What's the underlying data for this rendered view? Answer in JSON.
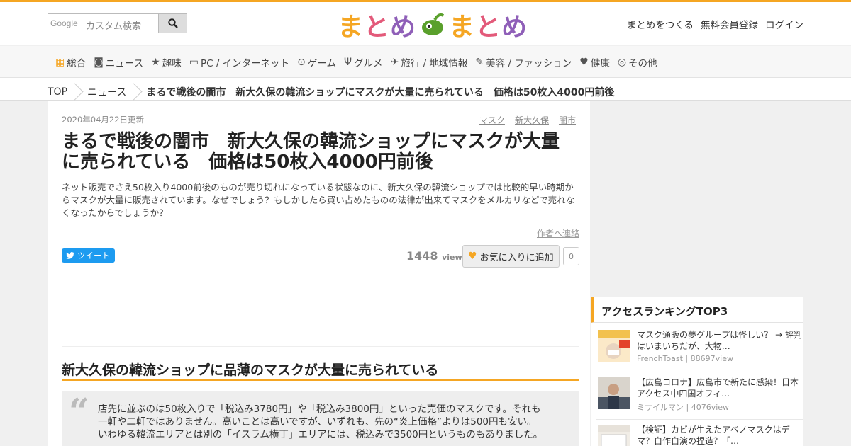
{
  "header": {
    "search_brand": "Google",
    "search_placeholder": "カスタム検索",
    "logo_chars": [
      "ま",
      "と",
      "め",
      "ま",
      "と",
      "め"
    ],
    "logo_colors": [
      "#f5a623",
      "#e35a7a",
      "#8f5fb8",
      "#f5a623",
      "#e35a7a",
      "#8f5fb8"
    ],
    "links": [
      "まとめをつくる",
      "無料会員登録",
      "ログイン"
    ]
  },
  "nav": {
    "items": [
      {
        "label": "総合",
        "icon": "grid-icon"
      },
      {
        "label": "ニュース",
        "icon": "camera-icon"
      },
      {
        "label": "趣味",
        "icon": "star-icon"
      },
      {
        "label": "PC / インターネット",
        "icon": "monitor-icon"
      },
      {
        "label": "ゲーム",
        "icon": "gamepad-icon"
      },
      {
        "label": "グルメ",
        "icon": "cutlery-icon"
      },
      {
        "label": "旅行 / 地域情報",
        "icon": "plane-icon"
      },
      {
        "label": "美容 / ファッション",
        "icon": "brush-icon"
      },
      {
        "label": "健康",
        "icon": "heartbeat-icon"
      },
      {
        "label": "その他",
        "icon": "dots-icon"
      }
    ]
  },
  "breadcrumb": {
    "top": "TOP",
    "category": "ニュース",
    "current": "まるで戦後の闇市　新大久保の韓流ショップにマスクが大量に売られている　価格は50枚入4000円前後"
  },
  "article": {
    "updated": "2020年04月22日更新",
    "tags": [
      "マスク",
      "新大久保",
      "闇市"
    ],
    "title": "まるで戦後の闇市　新大久保の韓流ショップにマスクが大量に売られている　価格は50枚入4000円前後",
    "description": "ネット販売でさえ50枚入り4000前後のものが売り切れになっている状態なのに、新大久保の韓流ショップでは比較的早い時期からマスクが大量に販売されています。なぜでしょう？もしかしたら買い占めたものの法律が出来てマスクをメルカリなどで売れなくなったからでしょうか？",
    "contact_author": "作者へ連絡",
    "tweet_label": "ツイート",
    "view_count": "1448",
    "view_unit": "view",
    "favorite_label": "お気に入りに追加",
    "favorite_count": "0",
    "section_heading": "新大久保の韓流ショップに品薄のマスクが大量に売られている",
    "quote_text": "店先に並ぶのは50枚入りで「税込み3780円」や「税込み3800円」といった売価のマスクです。それも一軒や二軒ではありません。高いことは高いですが、いずれも、先の“炎上価格”よりは500円も安い。いわゆる韓流エリアとは別の「イスラム横丁」エリアには、税込みで3500円というものもありました。"
  },
  "sidebar": {
    "ranking_title": "アクセスランキングTOP3",
    "items": [
      {
        "title": "マスク通販の夢グループは怪しい？ → 評判はいまいちだが、大物…",
        "author": "FrenchToast | 88697view"
      },
      {
        "title": "【広島コロナ】広島市で新たに感染！日本アクセス中四国オフィ…",
        "author": "ミサイルマン | 4076view"
      },
      {
        "title": "【検証】カビが生えたアベノマスクはデマ？自作自演の捏造？「…",
        "author": ""
      }
    ]
  },
  "colors": {
    "accent": "#f5a623",
    "tweet": "#1d9bf0"
  }
}
